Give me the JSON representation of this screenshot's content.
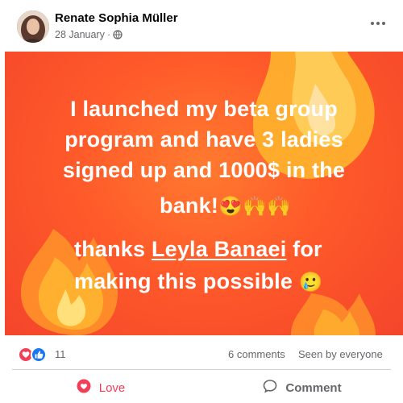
{
  "post": {
    "author": "Renate Sophia Müller",
    "date": "28 January",
    "separator": "·",
    "audience_icon": "globe-icon",
    "more_icon": "more-icon"
  },
  "content": {
    "line1": "I launched my beta group",
    "line2": "program and have 3 ladies",
    "line3": "signed up and 1000$ in the",
    "line4_text": "bank!",
    "line4_emoji": "😍🙌🙌",
    "line5_prefix": "thanks ",
    "mention": "Leyla Banaei",
    "line5_suffix": " for",
    "line6_text": "making this possible",
    "line6_emoji": "🥲"
  },
  "stats": {
    "reactions_count": "11",
    "reaction_icons": [
      "love-reaction-icon",
      "like-reaction-icon"
    ],
    "comments": "6 comments",
    "seen": "Seen by everyone"
  },
  "actions": {
    "love_label": "Love",
    "comment_label": "Comment"
  },
  "colors": {
    "love": "#f33e58",
    "like": "#1877f2",
    "background_orange": "#ff5a2a",
    "muted_text": "#65676b"
  }
}
